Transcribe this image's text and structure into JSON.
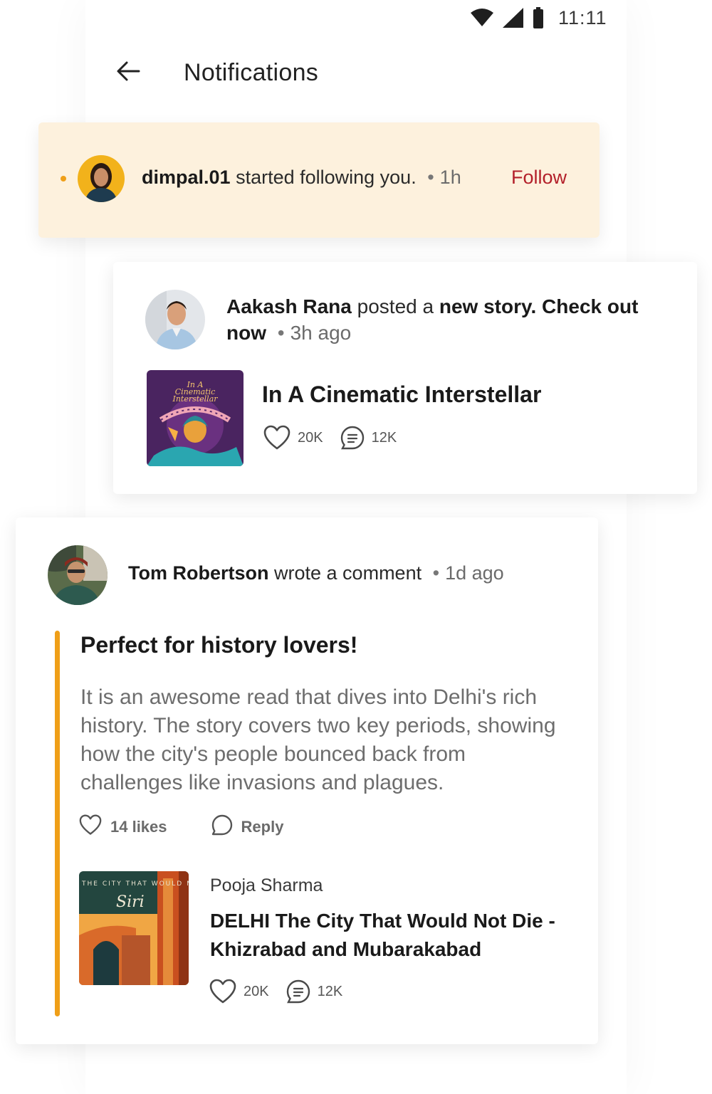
{
  "status_bar": {
    "time": "11:11"
  },
  "header": {
    "title": "Notifications"
  },
  "follow_notification": {
    "username": "dimpal.01",
    "text": "started following you.",
    "time": "1h",
    "follow_label": "Follow",
    "highlight_color": "#fdf1dd",
    "unread": true
  },
  "story_notification": {
    "author": "Aakash Rana",
    "text": "posted a",
    "highlight": "new story. Check out now",
    "time": "3h ago",
    "story": {
      "cover_title": "In A Cinematic Interstellar",
      "title": "In A Cinematic Interstellar",
      "likes": "20K",
      "comments": "12K"
    }
  },
  "comment_notification": {
    "author": "Tom Robertson",
    "text": "wrote a comment",
    "time": "1d ago",
    "comment": {
      "heading": "Perfect for history lovers!",
      "body": "It is an awesome read that dives into Delhi's rich history. The story covers two key periods, showing how the city's people bounced back from challenges like invasions and plagues.",
      "likes_label": "14 likes",
      "reply_label": "Reply",
      "accent_color": "#ef9f18"
    },
    "book": {
      "cover_top_text": "THE CITY THAT WOULD N",
      "cover_script": "Siri",
      "author": "Pooja Sharma",
      "title": "DELHI The City That Would Not Die - Khizrabad and Mubarakabad",
      "likes": "20K",
      "comments": "12K"
    }
  },
  "icons": {
    "wifi": "wifi-icon",
    "signal": "signal-icon",
    "battery": "battery-icon",
    "back": "arrow-left-icon",
    "heart": "heart-icon",
    "comment": "comment-icon",
    "reply": "reply-bubble-icon"
  },
  "colors": {
    "accent": "#ef9f18",
    "follow": "#b3202a"
  }
}
